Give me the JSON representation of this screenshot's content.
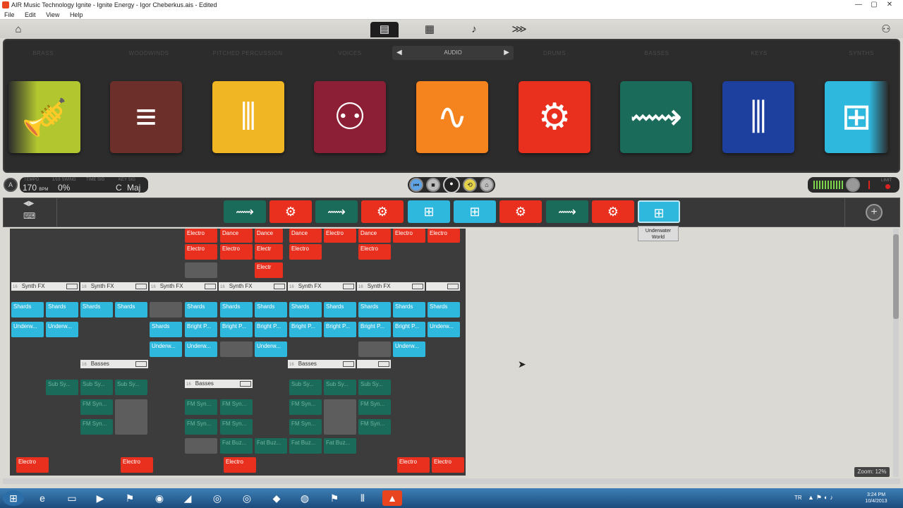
{
  "window": {
    "title": "AIR Music Technology Ignite - Ignite Energy - Igor Cheberkus.ais - Edited",
    "controls": [
      "—",
      "▢",
      "✕"
    ]
  },
  "menu": [
    "File",
    "Edit",
    "View",
    "Help"
  ],
  "categories": [
    "BRASS",
    "WOODWINDS",
    "PITCHED PERCUSSION",
    "VOICES",
    "DRUMS",
    "BASSES",
    "KEYS",
    "SYNTHS"
  ],
  "audio_selector": {
    "label": "AUDIO",
    "left": "◀",
    "right": "▶"
  },
  "transport": {
    "tempo_label": "TEMPO",
    "tempo": "170",
    "tempo_unit": "BPM",
    "swing_label": "1/16 SWING",
    "swing": "0%",
    "time_sig_label": "TIME SIG",
    "key_label": "KEY SIG",
    "key": "C",
    "mode": "Maj",
    "limit_label": "LIMIT"
  },
  "tracks_tooltip": "Underwater World",
  "arranger": {
    "headers": [
      {
        "n": "16",
        "name": "Synth FX"
      },
      {
        "n": "16",
        "name": "Synth FX"
      },
      {
        "n": "16",
        "name": "Synth FX"
      },
      {
        "n": "16",
        "name": "Synth FX"
      },
      {
        "n": "16",
        "name": "Synth FX"
      },
      {
        "n": "16",
        "name": "Synth FX"
      },
      {
        "n": "16",
        "name": "Basses"
      },
      {
        "n": "16",
        "name": "Basses"
      },
      {
        "n": "16",
        "name": "Basses"
      }
    ],
    "clips": {
      "shards": "Shards",
      "underw": "Underw...",
      "bright": "Bright P...",
      "electro": "Electro",
      "electr": "Electr",
      "dance": "Dance",
      "subsy": "Sub Sy...",
      "fmsyn": "FM Syn...",
      "fatbuz": "Fat Buz..."
    }
  },
  "zoom": "Zoom: 12%",
  "taskbar": {
    "lang": "TR",
    "time": "3:24 PM",
    "date": "10/4/2013"
  }
}
